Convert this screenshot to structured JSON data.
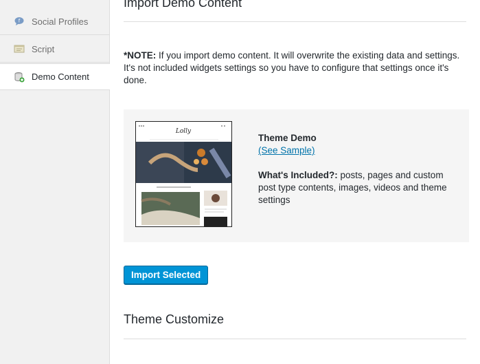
{
  "sidebar": {
    "items": [
      {
        "label": "Social Profiles",
        "icon": "speech-bubble-icon"
      },
      {
        "label": "Script",
        "icon": "script-window-icon"
      },
      {
        "label": "Demo Content",
        "icon": "database-add-icon",
        "active": true
      }
    ]
  },
  "main": {
    "import_heading": "Import Demo Content",
    "note_label": "*NOTE:",
    "note_text": " If you import demo content. It will overwrite the existing data and settings. It's not included widgets settings so you have to configure that settings once it's done.",
    "demo": {
      "title": "Theme Demo",
      "sample_link": "(See Sample)",
      "included_label": "What's Included?:",
      "included_text": " posts, pages and custom post type contents, images, videos and theme settings"
    },
    "import_button": "Import Selected",
    "customize_heading": "Theme Customize"
  },
  "colors": {
    "accent": "#0094d6",
    "link": "#0073aa",
    "sidebar_bg": "#f1f1f1",
    "box_bg": "#f5f5f5"
  }
}
